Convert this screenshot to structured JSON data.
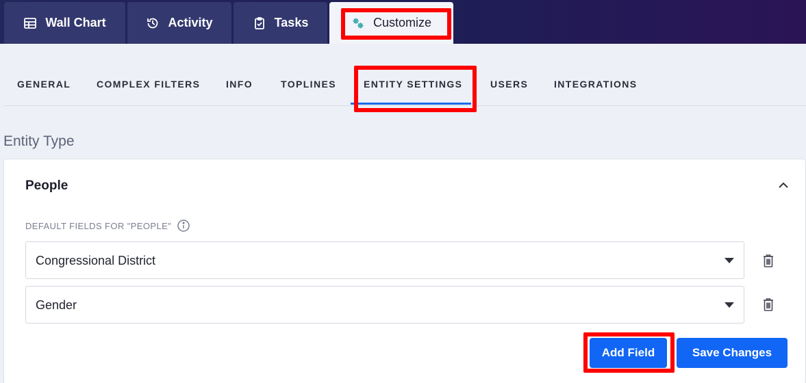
{
  "top_tabs": [
    {
      "label": "Wall Chart",
      "icon": "table-icon"
    },
    {
      "label": "Activity",
      "icon": "history-icon"
    },
    {
      "label": "Tasks",
      "icon": "clipboard-check-icon"
    },
    {
      "label": "Customize",
      "icon": "gears-icon",
      "active": true
    }
  ],
  "sub_tabs": [
    "GENERAL",
    "COMPLEX FILTERS",
    "INFO",
    "TOPLINES",
    "ENTITY SETTINGS",
    "USERS",
    "INTEGRATIONS"
  ],
  "active_sub_tab": "ENTITY SETTINGS",
  "section_title": "Entity Type",
  "card": {
    "title": "People",
    "fields_label": "DEFAULT FIELDS FOR \"PEOPLE\"",
    "fields": [
      {
        "value": "Congressional District"
      },
      {
        "value": "Gender"
      }
    ],
    "add_field_label": "Add Field",
    "save_label": "Save Changes"
  },
  "colors": {
    "accent": "#1166f5",
    "highlight": "#ff0000",
    "topbar": "#23265a"
  }
}
